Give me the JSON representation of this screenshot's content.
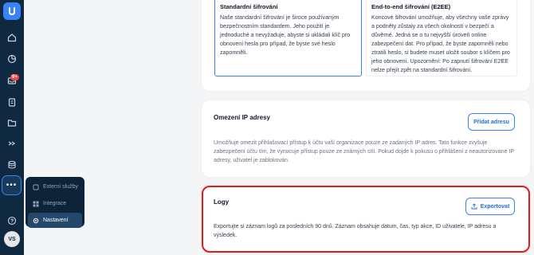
{
  "sidebar": {
    "logo_letter": "U",
    "notification_badge": "9+",
    "more_label": "•••",
    "avatar_initials": "VS"
  },
  "popup_menu": {
    "items": [
      {
        "label": "Externí služby",
        "active": false
      },
      {
        "label": "Integrace",
        "active": false
      },
      {
        "label": "Nastavení",
        "active": true
      }
    ]
  },
  "encryption": {
    "standard": {
      "title": "Standardní šifrování",
      "description": "Naše standardní šifrování je široce používaným bezpečnostním standardem. Jeho použití je jednoduché a nevyžaduje, abyste si ukládali klíč pro obnovení hesla pro případ, že byste své heslo zapomněli."
    },
    "e2ee": {
      "title": "End-to-end šifrování (E2EE)",
      "description": "Koncové šifrování umožňuje, aby všechny vaše zprávy a podněty zůstaly za všech okolností v bezpečí a důvěrné. Jedná se o tu nejvyšší úroveň online zabezpečení dat. Pro případ, že byste zapomněli nebo ztratili heslo, si budete muset uložit soubor s klíčem pro jeho obnovení. Upozornění: Po zapnutí šifrování E2EE nelze přejít zpět na standardní šifrování."
    }
  },
  "ip_restriction": {
    "title": "Omezení IP adresy",
    "button": "Přidat adresu",
    "description": "Umožňuje omezit přihlašovací přístup k účtu vaší organizace pouze ze zadaných IP adres. Tato funkce zvyšuje zabezpečení účtu tím, že vynucuje přístup pouze ze známých sítí. Pokud dojde k pokusu o přihlášení z neautorizované IP adresy, uživatel je zablokován."
  },
  "logs": {
    "title": "Logy",
    "button": "Exportovat",
    "description": "Exportujte si záznam logů za posledních 90 dnů. Záznam obsahuje datum, čas, typ akce, ID uživatele, IP adresu a výsledek."
  },
  "colors": {
    "sidebar": "#0f2940",
    "accent": "#3b82f6",
    "highlight_border": "#e11d1d"
  }
}
